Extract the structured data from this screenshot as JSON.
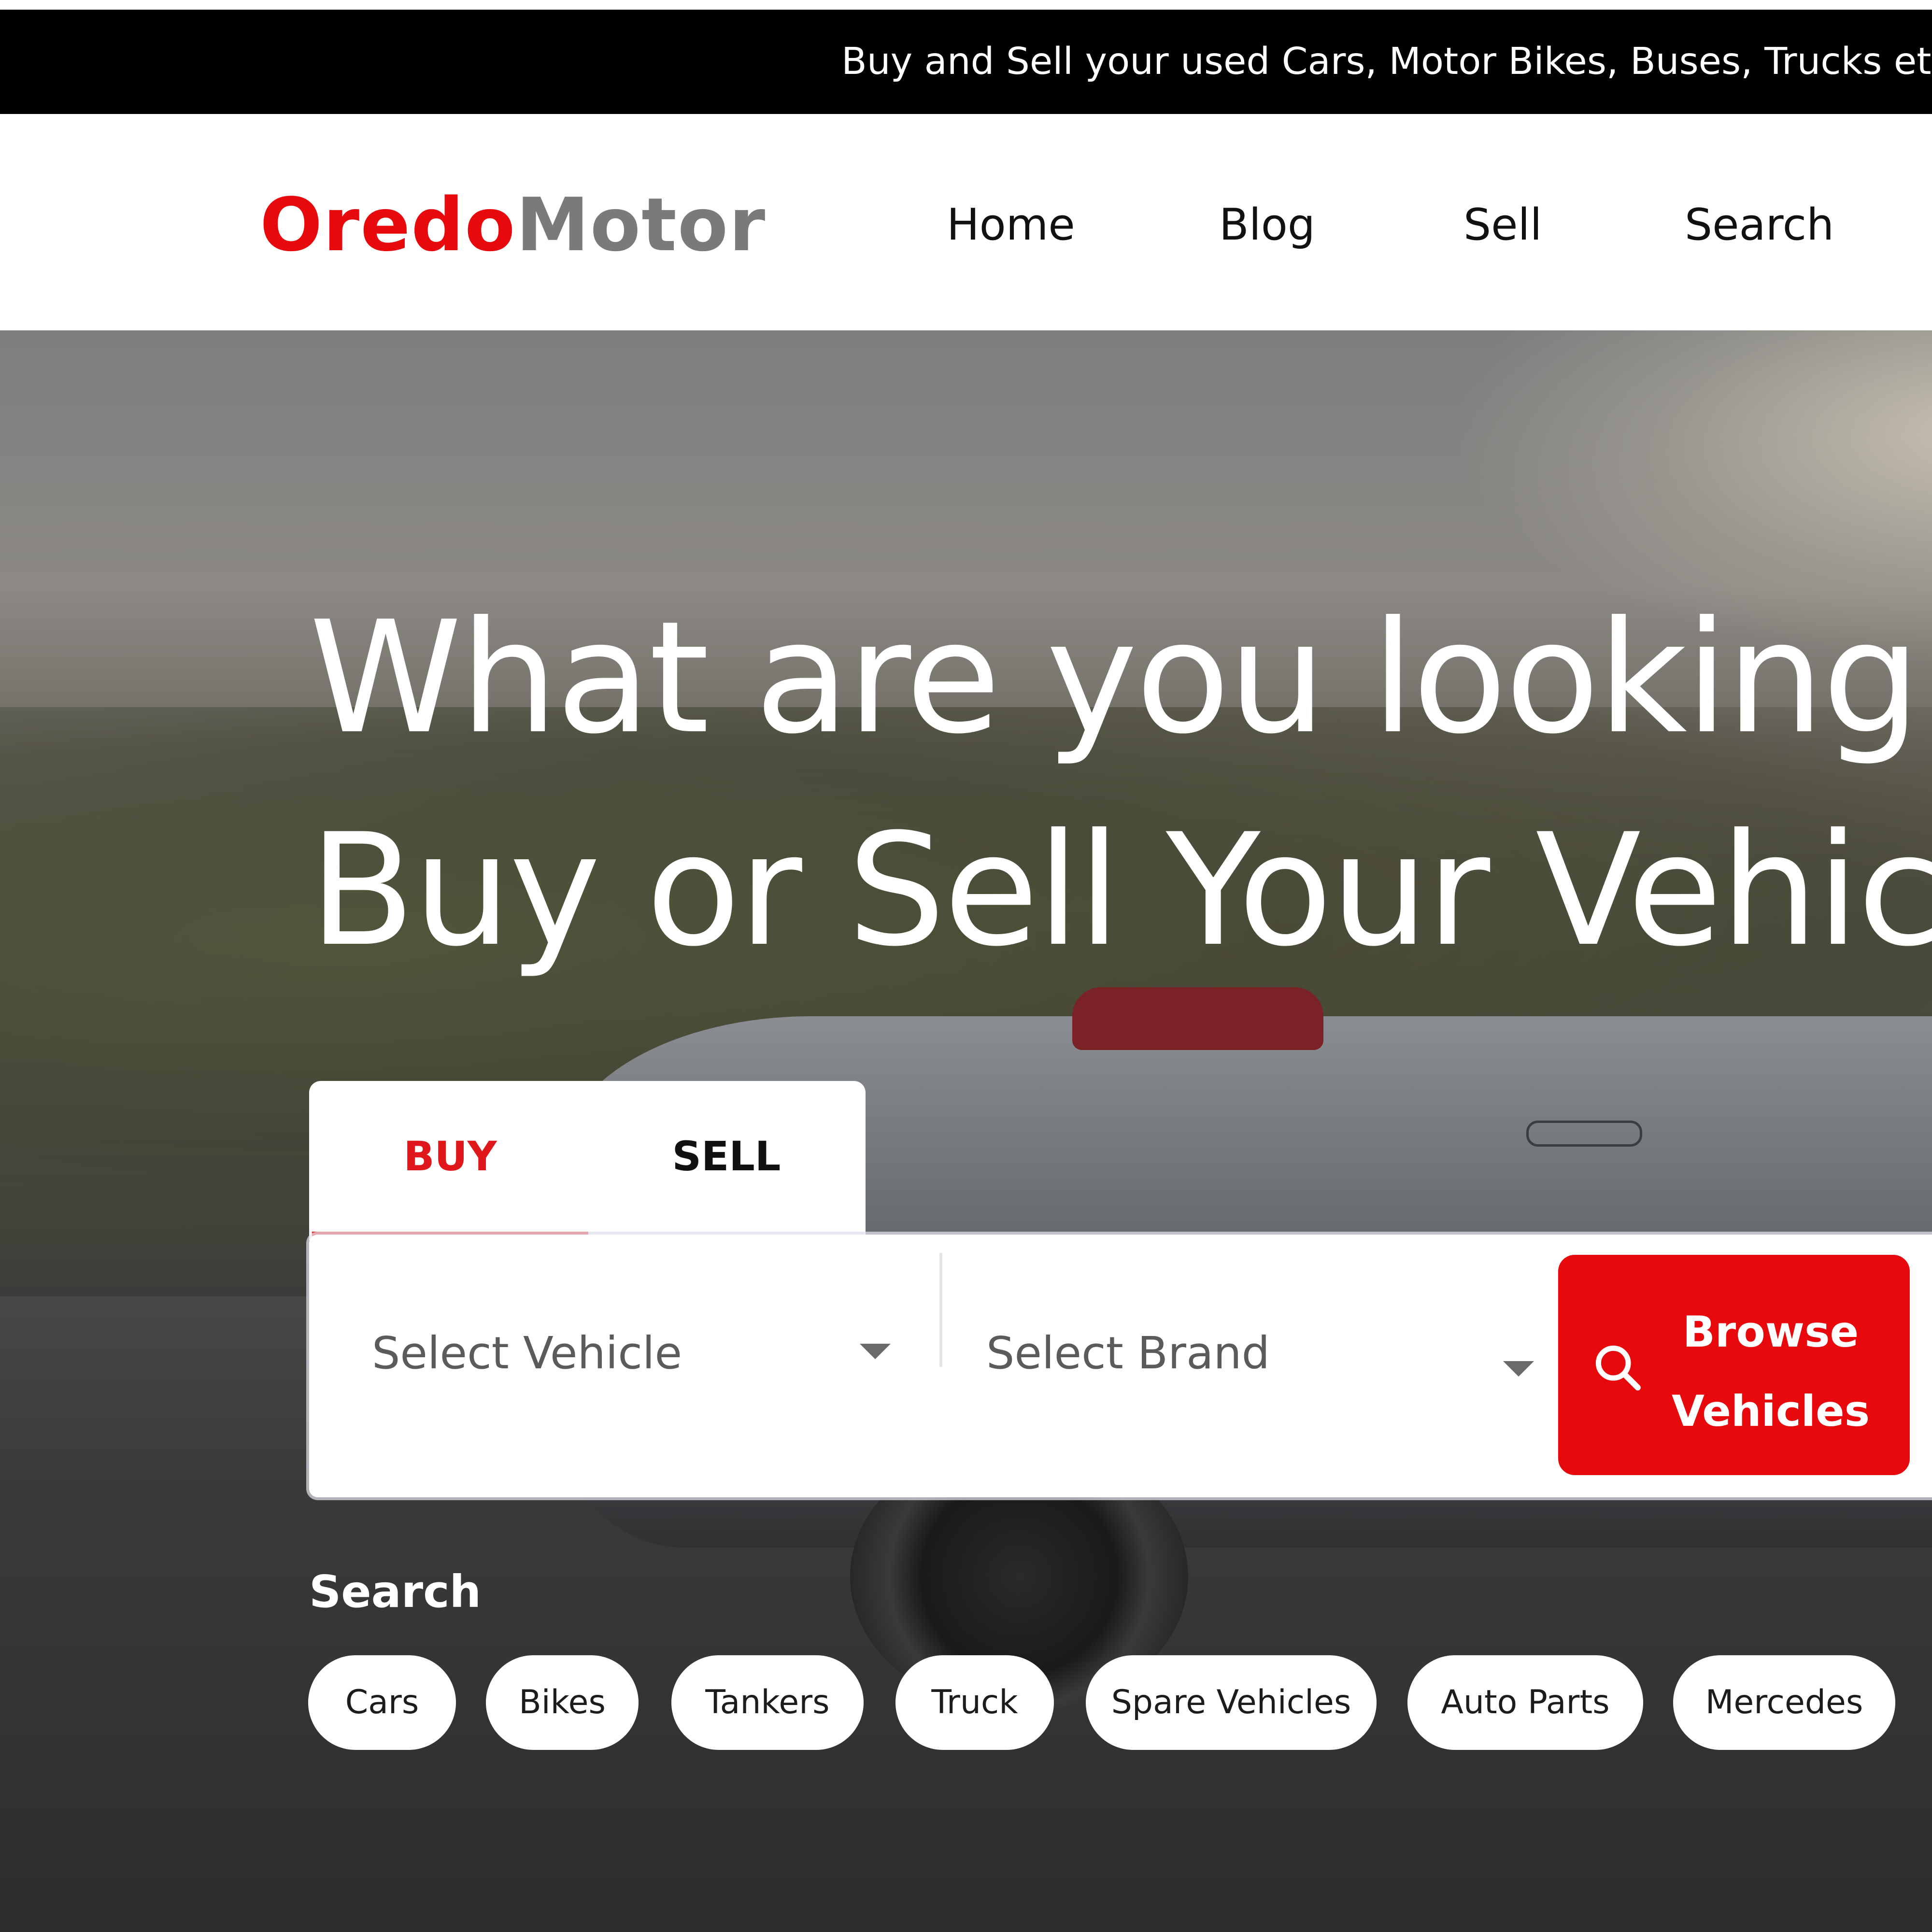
{
  "announcement": {
    "text": "Buy and Sell your used Cars, Motor Bikes, Buses, Trucks etc"
  },
  "header": {
    "logo": {
      "part1": "Oredo",
      "part2": "Motor"
    },
    "nav": [
      {
        "label": "Home"
      },
      {
        "label": "Blog"
      },
      {
        "label": "Sell"
      },
      {
        "label": "Search"
      }
    ]
  },
  "hero": {
    "title_line1": "What are you looking f",
    "title_line2": "Buy or Sell Your Vehicle"
  },
  "search_widget": {
    "tabs": [
      {
        "label": "BUY",
        "active": true
      },
      {
        "label": "SELL",
        "active": false
      }
    ],
    "vehicle_select": {
      "value": "Select Vehicle"
    },
    "brand_select": {
      "value": "Select Brand"
    },
    "browse_button": {
      "label_line1": "Browse",
      "label_line2": "Vehicles",
      "icon": "search-icon"
    }
  },
  "quick_search": {
    "heading": "Search",
    "chips": [
      {
        "label": "Cars"
      },
      {
        "label": "Bikes"
      },
      {
        "label": "Tankers"
      },
      {
        "label": "Truck"
      },
      {
        "label": "Spare Vehicles"
      },
      {
        "label": "Auto Parts"
      },
      {
        "label": "Mercedes"
      }
    ]
  },
  "colors": {
    "brand_red": "#e8090d",
    "logo_gray": "#7a7a7a",
    "announcement_bg": "#000000"
  }
}
